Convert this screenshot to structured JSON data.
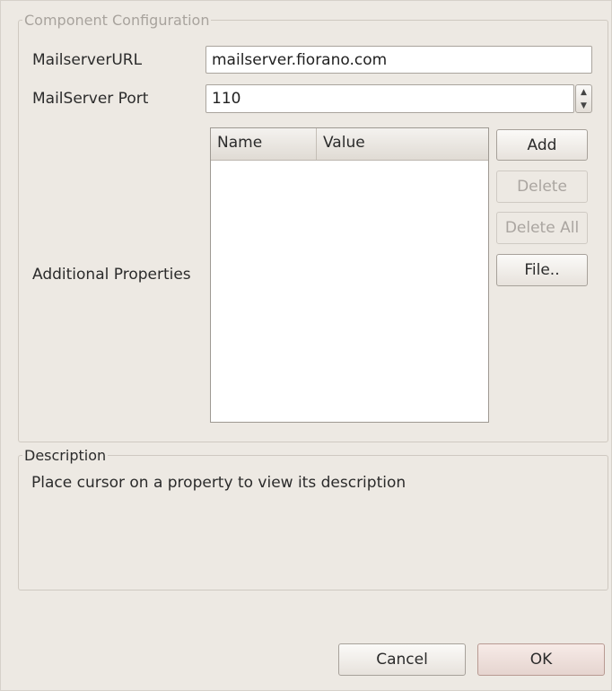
{
  "config": {
    "legend": "Component Configuration",
    "mailserver_url_label": "MailserverURL",
    "mailserver_url_value": "mailserver.fiorano.com",
    "port_label": "MailServer Port",
    "port_value": "110",
    "additional_properties_label": "Additional Properties",
    "table": {
      "columns": [
        "Name",
        "Value"
      ],
      "rows": []
    },
    "buttons": {
      "add": "Add",
      "delete": "Delete",
      "delete_all": "Delete All",
      "file": "File.."
    }
  },
  "description": {
    "legend": "Description",
    "text": "Place cursor on a property to view its description"
  },
  "footer": {
    "cancel": "Cancel",
    "ok": "OK"
  },
  "icons": {
    "spin_up": "chevron-up-icon",
    "spin_down": "chevron-down-icon"
  }
}
